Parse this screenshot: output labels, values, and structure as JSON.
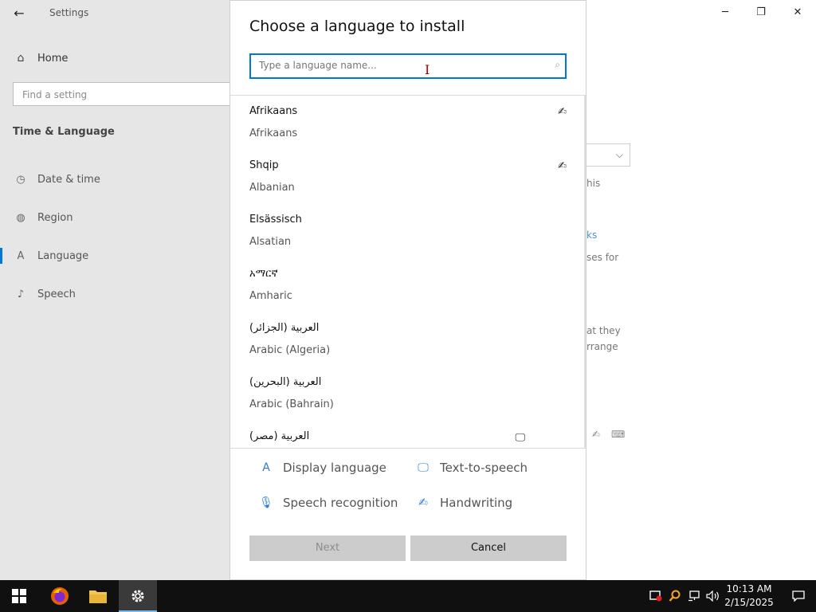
{
  "window": {
    "app_title": "Settings",
    "back_icon": "←",
    "controls": {
      "minimize": "─",
      "restore": "❐",
      "close": "✕"
    }
  },
  "sidebar": {
    "home_icon": "⌂",
    "home_label": "Home",
    "search_placeholder": "Find a setting",
    "section_title": "Time & Language",
    "items": [
      {
        "icon": "◷",
        "label": "Date & time",
        "icon_name": "date-time-icon"
      },
      {
        "icon": "◍",
        "label": "Region",
        "icon_name": "globe-icon"
      },
      {
        "icon": "A",
        "label": "Language",
        "icon_name": "language-icon",
        "active": true
      },
      {
        "icon": "♪",
        "label": "Speech",
        "icon_name": "microphone-icon"
      }
    ]
  },
  "background": {
    "dropdown_chevron": "⌵",
    "snippets": [
      "his",
      "ks",
      "ses for",
      "at they",
      "rrange"
    ]
  },
  "dialog": {
    "title": "Choose a language to install",
    "search_placeholder": "Type a language name...",
    "search_icon": "⌕",
    "languages": [
      {
        "native": "Afrikaans",
        "english": "Afrikaans",
        "feature_icon": "✍"
      },
      {
        "native": "Shqip",
        "english": "Albanian",
        "feature_icon": "✍"
      },
      {
        "native": "Elsässisch",
        "english": "Alsatian",
        "feature_icon": ""
      },
      {
        "native": "አማርኛ",
        "english": "Amharic",
        "feature_icon": ""
      },
      {
        "native": "العربية (الجزائر)",
        "english": "Arabic (Algeria)",
        "feature_icon": ""
      },
      {
        "native": "العربية (البحرين)",
        "english": "Arabic (Bahrain)",
        "feature_icon": ""
      },
      {
        "native": "العربية (مصر)",
        "english": "",
        "feature_icon": "🖵"
      }
    ],
    "legend": {
      "display_language": "Display language",
      "text_to_speech": "Text-to-speech",
      "speech_recognition": "Speech recognition",
      "handwriting": "Handwriting"
    },
    "next_label": "Next",
    "cancel_label": "Cancel"
  },
  "taskbar": {
    "time": "10:13 AM",
    "date": "2/15/2025"
  },
  "colors": {
    "accent": "#0078d7",
    "taskbar": "#101010",
    "button_bg": "#cccccc"
  }
}
